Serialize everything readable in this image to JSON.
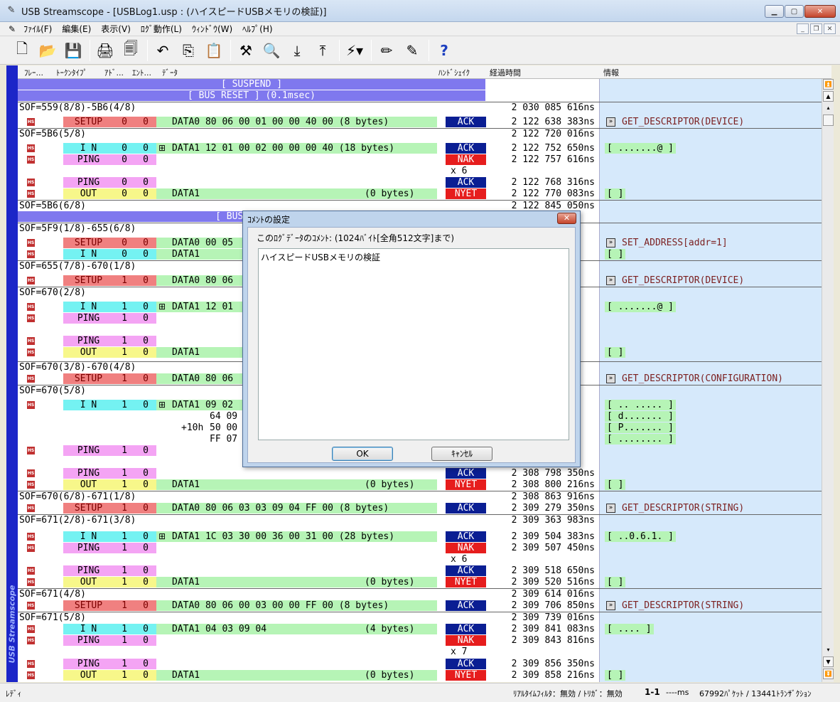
{
  "window": {
    "title": "USB Streamscope - [USBLog1.usp : (ハイスピードUSBメモリの検証)]"
  },
  "menu": [
    "ﾌｧｲﾙ(F)",
    "編集(E)",
    "表示(V)",
    "ﾛｸﾞ動作(L)",
    "ｳｨﾝﾄﾞｳ(W)",
    "ﾍﾙﾌﾟ(H)"
  ],
  "columns": [
    "ﾌﾚｰ...",
    "ﾄｰｸﾝﾀｲﾌﾟ",
    "ｱﾄﾞ...",
    "ｴﾝﾄ...",
    "ﾃﾞｰﾀ",
    "ﾊﾝﾄﾞｼｪｲｸ",
    "経過時間",
    "情報"
  ],
  "side_label": "USB Streamscope",
  "bands": [
    "[ SUSPEND ]",
    "[ BUS RESET ] (0.1msec)",
    "[ BUS RESET ]"
  ],
  "rows": [
    {
      "sof": "SOF=559(8/8)-5B6(4/8)",
      "time": "2 030 085 616ns"
    },
    {
      "marker": "1",
      "tok": "SETUP",
      "adr": "0",
      "ep": "0",
      "data": "DATA0  80 06 00 01 00 00 40 00 (8 bytes)",
      "hsk": "ACK",
      "time": "2 122 638 383ns",
      "info": "GET_DESCRIPTOR(DEVICE)"
    },
    {
      "sof": "SOF=5B6(5/8)",
      "time": "2 122 720 016ns"
    },
    {
      "tok": "I N",
      "adr": "0",
      "ep": "0",
      "data": "DATA1  12 01 00 02 00 00 00 40 (18 bytes)",
      "hsk": "ACK",
      "time": "2 122 752 650ns",
      "info": "[ .......@ ]"
    },
    {
      "tok": "PING",
      "adr": "0",
      "ep": "0",
      "hsk": "NAK",
      "time": "2 122 757 616ns"
    },
    {
      "repeat": "x 6"
    },
    {
      "tok": "PING",
      "adr": "0",
      "ep": "0",
      "hsk": "ACK",
      "time": "2 122 768 316ns"
    },
    {
      "tok": "OUT",
      "adr": "0",
      "ep": "0",
      "data": "DATA1",
      "bytes": "(0 bytes)",
      "hsk": "NYET",
      "time": "2 122 770 083ns",
      "info": "[ ]"
    },
    {
      "sof": "SOF=5B6(6/8)",
      "time": "2 122 845 050ns"
    },
    {
      "sof": "SOF=5F9(1/8)-655(6/8)"
    },
    {
      "tok": "SETUP",
      "adr": "0",
      "ep": "0",
      "data": "DATA0  00 05",
      "info": "SET_ADDRESS[addr=1]"
    },
    {
      "tok": "I N",
      "adr": "0",
      "ep": "0",
      "data": "DATA1",
      "info": "[ ]"
    },
    {
      "sof": "SOF=655(7/8)-670(1/8)"
    },
    {
      "tok": "SETUP",
      "adr": "1",
      "ep": "0",
      "data": "DATA0  80 06",
      "info": "GET_DESCRIPTOR(DEVICE)"
    },
    {
      "sof": "SOF=670(2/8)"
    },
    {
      "tok": "I N",
      "adr": "1",
      "ep": "0",
      "data": "DATA1  12 01",
      "info": "[ .......@ ]"
    },
    {
      "tok": "PING",
      "adr": "1",
      "ep": "0"
    },
    {
      "tok": "PING",
      "adr": "1",
      "ep": "0"
    },
    {
      "tok": "OUT",
      "adr": "1",
      "ep": "0",
      "data": "DATA1",
      "info": "[ ]"
    },
    {
      "sof": "SOF=670(3/8)-670(4/8)"
    },
    {
      "marker": "3",
      "tok": "SETUP",
      "adr": "1",
      "ep": "0",
      "data": "DATA0  80 06",
      "info": "GET_DESCRIPTOR(CONFIGURATION)"
    },
    {
      "sof": "SOF=670(5/8)"
    },
    {
      "tok": "I N",
      "adr": "1",
      "ep": "0",
      "data": "DATA1  09 02",
      "info": "[ .. ..... ]"
    },
    {
      "data2": "64 09",
      "info": "[ d....... ]"
    },
    {
      "offset": "+10h",
      "data2": "50 00",
      "info": "[ P....... ]"
    },
    {
      "data2": "FF 07",
      "info": "[ ........ ]"
    },
    {
      "tok": "PING",
      "adr": "1",
      "ep": "0"
    },
    {
      "tok": "PING",
      "adr": "1",
      "ep": "0",
      "hsk": "ACK",
      "time": "2 308 798 350ns"
    },
    {
      "tok": "OUT",
      "adr": "1",
      "ep": "0",
      "data": "DATA1",
      "bytes": "(0 bytes)",
      "hsk": "NYET",
      "time": "2 308 800 216ns",
      "info": "[ ]"
    },
    {
      "sof": "SOF=670(6/8)-671(1/8)",
      "time": "2 308 863 916ns"
    },
    {
      "tok": "SETUP",
      "adr": "1",
      "ep": "0",
      "data": "DATA0  80 06 03 03 09 04 FF 00 (8 bytes)",
      "hsk": "ACK",
      "time": "2 309 279 350ns",
      "info": "GET_DESCRIPTOR(STRING)"
    },
    {
      "sof": "SOF=671(2/8)-671(3/8)",
      "time": "2 309 363 983ns"
    },
    {
      "marker": "2",
      "tok": "I N",
      "adr": "1",
      "ep": "0",
      "data": "DATA1  1C 03 30 00 36 00 31 00 (28 bytes)",
      "hsk": "ACK",
      "time": "2 309 504 383ns",
      "info": "[ ..0.6.1. ]"
    },
    {
      "tok": "PING",
      "adr": "1",
      "ep": "0",
      "hsk": "NAK",
      "time": "2 309 507 450ns"
    },
    {
      "repeat": "x 6"
    },
    {
      "tok": "PING",
      "adr": "1",
      "ep": "0",
      "hsk": "ACK",
      "time": "2 309 518 650ns"
    },
    {
      "tok": "OUT",
      "adr": "1",
      "ep": "0",
      "data": "DATA1",
      "bytes": "(0 bytes)",
      "hsk": "NYET",
      "time": "2 309 520 516ns",
      "info": "[ ]"
    },
    {
      "sof": "SOF=671(4/8)",
      "time": "2 309 614 016ns"
    },
    {
      "tok": "SETUP",
      "adr": "1",
      "ep": "0",
      "data": "DATA0  80 06 00 03 00 00 FF 00 (8 bytes)",
      "hsk": "ACK",
      "time": "2 309 706 850ns",
      "info": "GET_DESCRIPTOR(STRING)"
    },
    {
      "sof": "SOF=671(5/8)",
      "time": "2 309 739 016ns"
    },
    {
      "tok": "I N",
      "adr": "1",
      "ep": "0",
      "data": "DATA1  04 03 09 04",
      "bytes": "(4 bytes)",
      "hsk": "ACK",
      "time": "2 309 841 083ns",
      "info": "[ .... ]"
    },
    {
      "tok": "PING",
      "adr": "1",
      "ep": "0",
      "hsk": "NAK",
      "time": "2 309 843 816ns"
    },
    {
      "repeat": "x 7"
    },
    {
      "tok": "PING",
      "adr": "1",
      "ep": "0",
      "hsk": "ACK",
      "time": "2 309 856 350ns"
    },
    {
      "tok": "OUT",
      "adr": "1",
      "ep": "0",
      "data": "DATA1",
      "bytes": "(0 bytes)",
      "hsk": "NYET",
      "time": "2 309 858 216ns",
      "info": "[ ]"
    }
  ],
  "dialog": {
    "title": "ｺﾒﾝﾄの設定",
    "label": "このﾛｸﾞﾃﾞｰﾀのｺﾒﾝﾄ: (1024ﾊﾞｲﾄ[全角512文字]まで)",
    "value": "ハイスピードUSBメモリの検証",
    "ok": "OK",
    "cancel": "ｷｬﾝｾﾙ"
  },
  "status": {
    "left": "ﾚﾃﾞｨ",
    "filter": "ﾘｱﾙﾀｲﾑﾌｨﾙﾀ：無効 / ﾄﾘｶﾞ：無効",
    "range": "1-1",
    "ms": "----ms",
    "counts": "67992ﾊﾟｹｯﾄ / 13441ﾄﾗﾝｻﾞｸｼｮﾝ"
  }
}
